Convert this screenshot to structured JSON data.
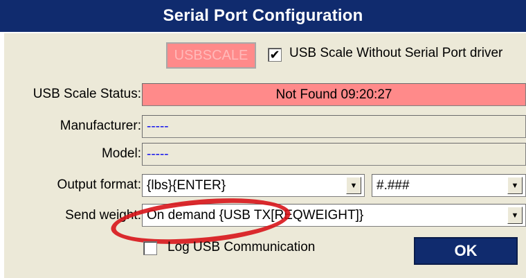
{
  "window": {
    "title": "Serial Port Configuration"
  },
  "usb": {
    "badge_text": "USBSCALE",
    "without_driver_checked": true,
    "without_driver_label": "USB Scale Without Serial Port driver"
  },
  "status": {
    "label": "USB Scale Status:",
    "value": "Not Found 09:20:27"
  },
  "manufacturer": {
    "label": "Manufacturer:",
    "value": "-----"
  },
  "model": {
    "label": "Model:",
    "value": "-----"
  },
  "output_format": {
    "label": "Output format:",
    "format_value": "{lbs}{ENTER}",
    "number_value": "#.###"
  },
  "send_weight": {
    "label": "Send weight:",
    "value": "On demand {USB TX[REQWEIGHT]}"
  },
  "log": {
    "checked": false,
    "label": "Log USB Communication"
  },
  "ok_label": "OK",
  "icons": {
    "check": "✔",
    "dropdown": "▼"
  },
  "colors": {
    "title_bar": "#102b6e",
    "status_bg": "#ff8a8a",
    "annotation": "#d8151b"
  }
}
